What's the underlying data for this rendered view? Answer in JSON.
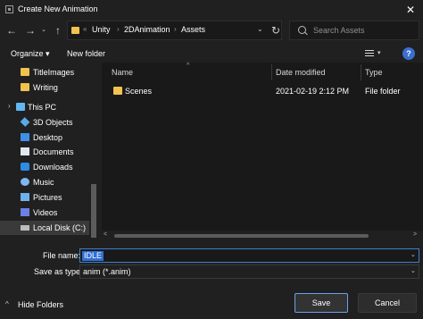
{
  "window": {
    "title": "Create New Animation",
    "close_glyph": "✕"
  },
  "nav": {
    "back_glyph": "←",
    "forward_glyph": "→",
    "caret_glyph": "⌄",
    "up_glyph": "↑",
    "refresh_glyph": "↻"
  },
  "address": {
    "prefix_sep": "«",
    "crumbs": [
      "Unity",
      "2DAnimation",
      "Assets"
    ],
    "sep": "›",
    "dropdown_glyph": "⌄"
  },
  "search": {
    "placeholder": "Search Assets"
  },
  "toolbar": {
    "organize": "Organize ▾",
    "new_folder": "New folder",
    "view_dropdown": "▾",
    "help": "?"
  },
  "sidebar": {
    "expander": "›",
    "items": [
      {
        "label": "TitleImages",
        "icon": "folder-icon"
      },
      {
        "label": "Writing",
        "icon": "folder-icon"
      },
      {
        "label": "This PC",
        "icon": "computer-icon"
      },
      {
        "label": "3D Objects",
        "icon": "3d-objects-icon"
      },
      {
        "label": "Desktop",
        "icon": "desktop-icon"
      },
      {
        "label": "Documents",
        "icon": "documents-icon"
      },
      {
        "label": "Downloads",
        "icon": "downloads-icon"
      },
      {
        "label": "Music",
        "icon": "music-icon"
      },
      {
        "label": "Pictures",
        "icon": "pictures-icon"
      },
      {
        "label": "Videos",
        "icon": "videos-icon"
      },
      {
        "label": "Local Disk (C:)",
        "icon": "disk-icon"
      }
    ]
  },
  "file_list": {
    "columns": [
      "Name",
      "Date modified",
      "Type"
    ],
    "sort_glyph": "^",
    "rows": [
      {
        "name": "Scenes",
        "date": "2021-02-19 2:12 PM",
        "type": "File folder"
      }
    ],
    "scroll_left": "<",
    "scroll_right": ">"
  },
  "form": {
    "filename_label": "File name:",
    "filename_value": "IDLE",
    "savetype_label": "Save as type:",
    "savetype_value": "anim (*.anim)",
    "dropdown_glyph": "⌄"
  },
  "footer": {
    "hide_folders": "Hide Folders",
    "hide_caret": "^",
    "save": "Save",
    "cancel": "Cancel"
  },
  "colors": {
    "background": "#202020",
    "pane": "#191919",
    "folder": "#f0c24e",
    "accent": "#3f7fd1"
  }
}
